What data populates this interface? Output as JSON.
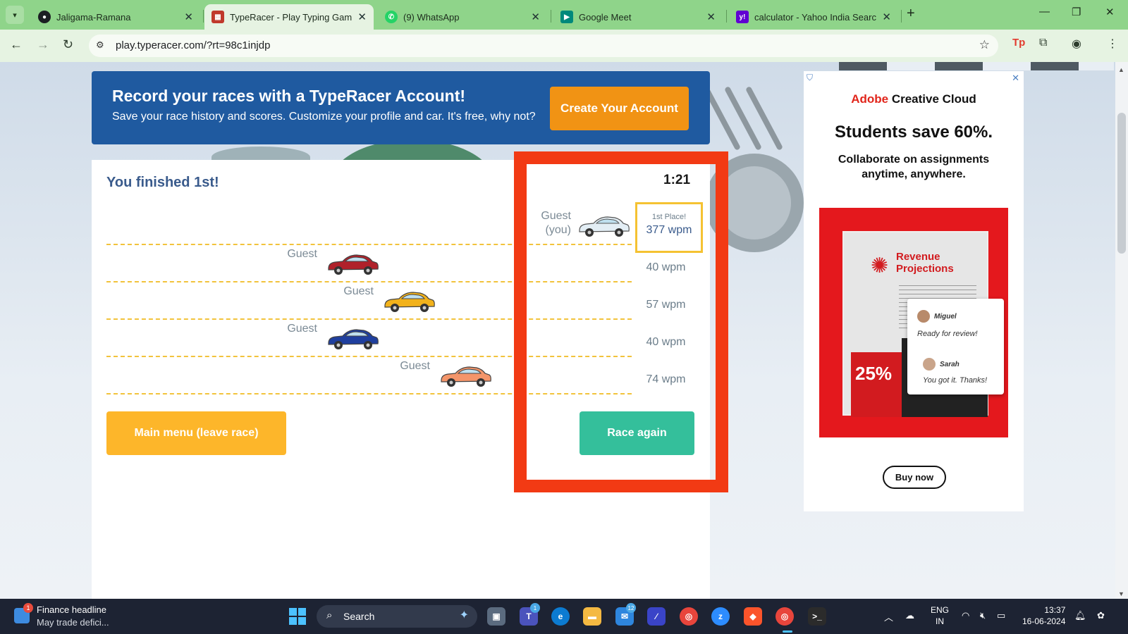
{
  "browser": {
    "tabs": [
      {
        "label": "Jaligama-Ramana",
        "icon": "github-icon",
        "color": "#1b1f23"
      },
      {
        "label": "TypeRacer - Play Typing Games",
        "icon": "typeracer-icon",
        "color": "#c0392b"
      },
      {
        "label": "(9) WhatsApp",
        "icon": "whatsapp-icon",
        "color": "#25d366"
      },
      {
        "label": "Google Meet",
        "icon": "google-meet-icon",
        "color": "#00897b"
      },
      {
        "label": "calculator - Yahoo India Search",
        "icon": "yahoo-icon",
        "color": "#6001d2"
      }
    ],
    "url": "play.typeracer.com/?rt=98c1injdp"
  },
  "banner": {
    "title": "Record your races with a TypeRacer Account!",
    "subtitle": "Save your race history and scores. Customize your profile and car. It's free, why not?",
    "button": "Create Your Account"
  },
  "race": {
    "status": "You finished 1st!",
    "timer": "1:21",
    "you_name_line1": "Guest",
    "you_name_line2": "(you)",
    "you_place": "1st Place!",
    "you_wpm": "377 wpm",
    "opponents": [
      {
        "name": "Guest",
        "wpm": "40 wpm",
        "car_color": "#b0212a"
      },
      {
        "name": "Guest",
        "wpm": "57 wpm",
        "car_color": "#f2b21b"
      },
      {
        "name": "Guest",
        "wpm": "40 wpm",
        "car_color": "#1f3f9e"
      },
      {
        "name": "Guest",
        "wpm": "74 wpm",
        "car_color": "#f4956a"
      }
    ],
    "you_car_color": "#e3eef5",
    "main_menu_button": "Main menu (leave race)",
    "race_again_button": "Race again",
    "highlight_color": "#f23a14"
  },
  "ad": {
    "brand_prefix": "Adobe",
    "brand_suffix": " Creative Cloud",
    "headline": "Students save 60%.",
    "body": "Collaborate on assignments anytime, anywhere.",
    "doc_title": "Revenue Projections",
    "percent": "25%",
    "chat_name_1": "Miguel",
    "chat_msg_1": "Ready for review!",
    "chat_name_2": "Sarah",
    "chat_msg_2": "You got it. Thanks!",
    "cta": "Buy now"
  },
  "taskbar": {
    "news_title": "Finance headline",
    "news_sub": "May trade defici...",
    "news_badge": "1",
    "search": "Search",
    "teams_badge": "1",
    "mail_badge": "12",
    "lang": "ENG",
    "region": "IN",
    "time": "13:37",
    "date": "16-06-2024"
  }
}
